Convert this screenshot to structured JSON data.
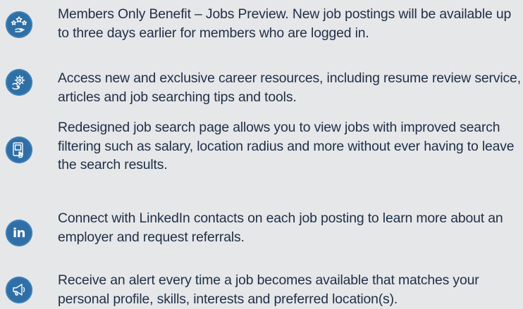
{
  "benefits": {
    "items": [
      {
        "icon": "stars-hand-icon",
        "text": "Members Only Benefit – Jobs Preview. New job postings will be available up to three days earlier for members who are logged in."
      },
      {
        "icon": "gear-hand-icon",
        "text": "Access new and exclusive career resources, including resume review service, articles and job searching tips and tools."
      },
      {
        "icon": "tablet-touch-icon",
        "text": "Redesigned job search page allows you to view jobs with improved search filtering such as salary, location radius and more without ever having to leave the search results."
      },
      {
        "icon": "linkedin-icon",
        "icon_text": "in",
        "text": "Connect with LinkedIn contacts on each job posting to learn more about an employer and request referrals."
      },
      {
        "icon": "megaphone-icon",
        "text": "Receive an alert every time a job becomes available that matches your personal profile, skills, interests and preferred location(s)."
      }
    ]
  },
  "colors": {
    "background": "#e6e7e9",
    "icon_fill": "#2f6fa6",
    "text": "#1f2f45"
  }
}
